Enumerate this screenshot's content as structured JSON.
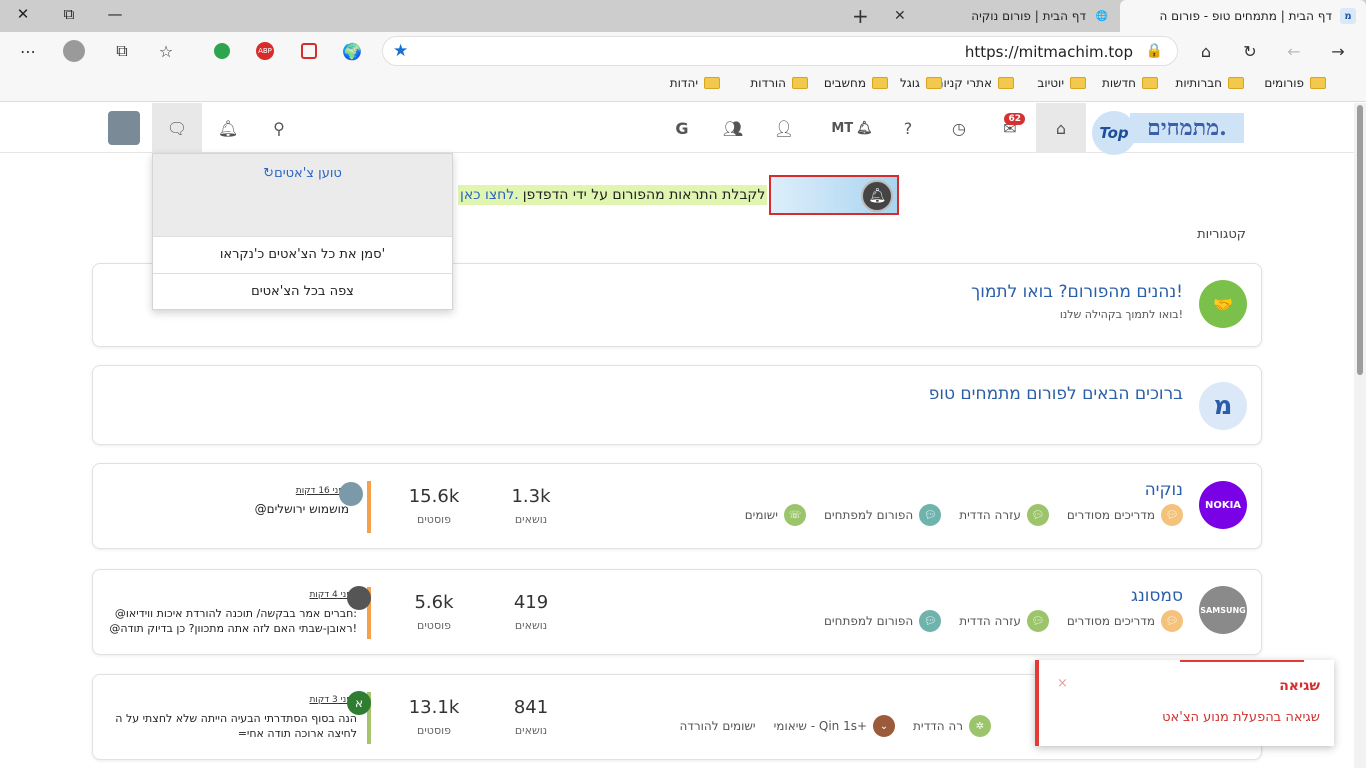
{
  "browser": {
    "tabs": [
      {
        "title": "דף הבית | מתמחים טופ - פורום ה",
        "active": true
      },
      {
        "title": "דף הבית | פורום נוקיה",
        "active": false
      }
    ],
    "url": "https://mitmachim.top",
    "bookmarks": [
      "פורומים",
      "חברותיות",
      "חדשות",
      "יוטיוב",
      "אתרי קניות",
      "גוגל",
      "מחשבים",
      "הורדות",
      "יהדות"
    ],
    "win_close": "✕",
    "win_restore": "⧉"
  },
  "nav": {
    "logo_text": "מתמחים.",
    "logo_top": "Top",
    "mt_label": "MT",
    "notif_count": "62",
    "google_label": "G"
  },
  "notice": {
    "text": "לקבלת התראות מהפורום על ידי הדפדפן",
    "link": "לחצו כאן."
  },
  "chat_dropdown": {
    "loading": "טוען צ'אטים",
    "mark_all_read": "סמן את כל הצ'אטים כ'נקראו'",
    "view_all": "צפה בכל הצ'אטים"
  },
  "section_title": "קטגוריות",
  "cards": {
    "support": {
      "title": "נהנים מהפורום? בואו לתמוך!",
      "subtitle": "בואו לתמוך בקהילה שלנו!"
    },
    "welcome": {
      "title": "ברוכים הבאים לפורום מתמחים טופ",
      "icon_letter": "מ"
    },
    "nokia": {
      "title": "נוקיה",
      "icon_label": "NOKIA",
      "subforums": [
        "מדריכים מסודרים",
        "עזרה הדדית",
        "הפורום למפתחים",
        "ישומים"
      ],
      "topics": "1.3k",
      "posts": "15.6k",
      "topics_label": "נושאים",
      "posts_label": "פוסטים",
      "last_when": "לפני 16 דקות",
      "last_text": "@מושמוש ירושלים"
    },
    "samsung": {
      "title": "סמסונג",
      "icon_label": "SAMSUNG",
      "subforums": [
        "מדריכים מסודרים",
        "עזרה הדדית",
        "הפורום למפתחים"
      ],
      "topics": "419",
      "posts": "5.6k",
      "topics_label": "נושאים",
      "posts_label": "פוסטים",
      "last_when": "לפני 4 דקות",
      "last_text": "@חברים אמר בבקשה/ תוכנה להורדת איכות ווידיאו:\n@ראובן-שבתי האם לזה אתה מתכוון? כן בדיוק תודה!"
    },
    "third": {
      "subforums": [
        "רה הדדית",
        "שיאומי - Qin 1s+",
        "ישומים להורדה"
      ],
      "topics": "841",
      "posts": "13.1k",
      "topics_label": "נושאים",
      "posts_label": "פוסטים",
      "last_when": "לפני 3 דקות",
      "last_avatar": "א",
      "last_text": "הנה בסוף הסתדרתי הבעיה הייתה שלא לחצתי על ה\n=לחיצה ארוכה תודה אחי"
    }
  },
  "toast": {
    "title": "שגיאה",
    "message": "שגיאה בהפעלת מנוע הצ'אט",
    "close": "×"
  },
  "colors": {
    "accent": "#2a5ea8",
    "error": "#e53935",
    "orange_bar": "#f5a04a",
    "green_bar": "#a5c46b"
  }
}
